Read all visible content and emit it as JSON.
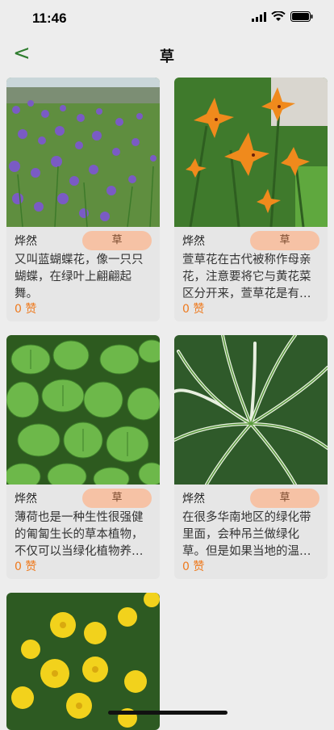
{
  "status_bar": {
    "time": "11:46"
  },
  "nav": {
    "back_icon": "<",
    "title": "草"
  },
  "cards": [
    {
      "author": "烨然",
      "tag": "草",
      "desc": "又叫蓝蝴蝶花，像一只只蝴蝶，在绿叶上翩翩起舞。",
      "likes": "0 赞"
    },
    {
      "author": "烨然",
      "tag": "草",
      "desc": "萱草花在古代被称作母亲花，注意要将它与黄花菜区分开来，萱草花是有…",
      "likes": "0 赞"
    },
    {
      "author": "烨然",
      "tag": "草",
      "desc": "薄荷也是一种生性很强健的匍匐生长的草本植物，不仅可以当绿化植物养…",
      "likes": "0 赞"
    },
    {
      "author": "烨然",
      "tag": "草",
      "desc": "在很多华南地区的绿化带里面，会种吊兰做绿化草。但是如果当地的温…",
      "likes": "0 赞"
    },
    {
      "author": "",
      "tag": "",
      "desc": "",
      "likes": ""
    }
  ],
  "colors": {
    "accent": "#ee7a1e",
    "tag_bg": "#f6c2a5",
    "back": "#2f7d2f"
  }
}
